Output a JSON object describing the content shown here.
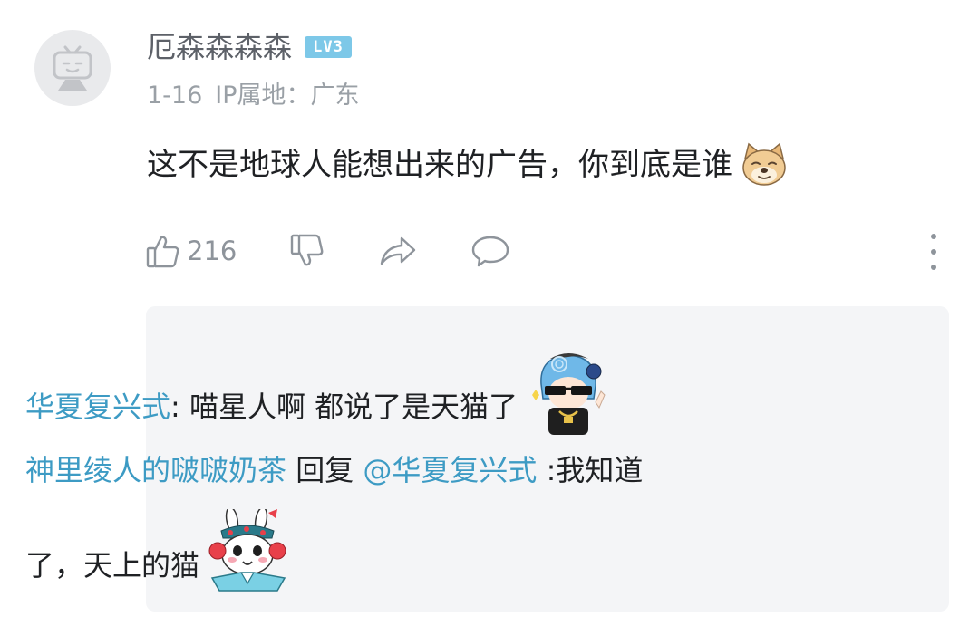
{
  "comment": {
    "username": "厄森森森森",
    "level_badge": "LV3",
    "date": "1-16",
    "ip_location": "IP属地：广东",
    "text": "这不是地球人能想出来的广告，你到底是谁",
    "sticker": "doge-sticker",
    "likes": "216",
    "icons": [
      "avatar-placeholder-icon",
      "thumbs-up-icon",
      "thumbs-down-icon",
      "share-icon",
      "reply-icon",
      "more-vertical-icon"
    ]
  },
  "replies": [
    {
      "user": "华夏复兴式",
      "separator": ": ",
      "text": "喵星人啊 都说了是天猫了",
      "sticker": "sunglasses-character-sticker"
    },
    {
      "user": "神里绫人的啵啵奶茶",
      "action": " 回复 ",
      "mention": "@华夏复兴式",
      "text_line1": " :我知道",
      "text_line2": "了，天上的猫",
      "sticker": "rabbit-opera-sticker"
    }
  ],
  "colors": {
    "username": "#5d6168",
    "meta": "#9aa0a6",
    "link": "#3d9bc4",
    "level_badge": "#7dc8e8",
    "reply_bg": "#f4f5f7"
  }
}
